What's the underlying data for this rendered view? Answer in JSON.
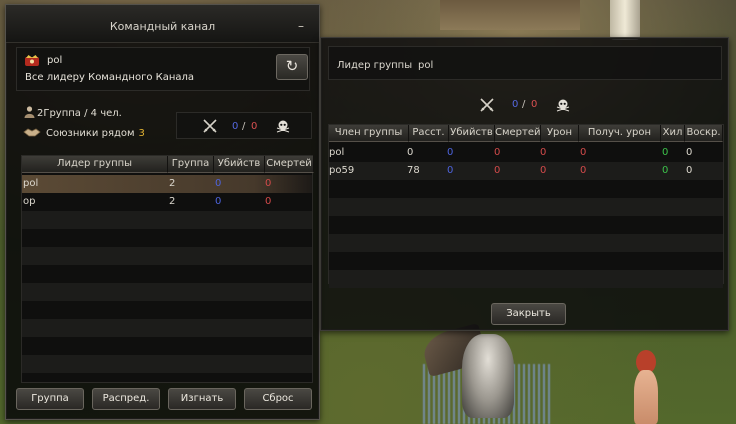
{
  "command_channel": {
    "title": "Командный канал",
    "minimize_label": "–",
    "leader_name": "pol",
    "leader_line": "Все лидеру Командного Канала",
    "refresh_icon": "refresh-icon",
    "groups_info": "2Группа / 4 чел.",
    "allies_label": "Союзники рядом",
    "allies_count": "3",
    "score": {
      "kills": "0",
      "separator": "/",
      "deaths": "0"
    },
    "table": {
      "headers": [
        "Лидер группы",
        "Группа",
        "Убийств",
        "Смертей"
      ],
      "rows": [
        {
          "leader": "pol",
          "group": "2",
          "kills": "0",
          "deaths": "0"
        },
        {
          "leader": "op",
          "group": "2",
          "kills": "0",
          "deaths": "0"
        }
      ]
    },
    "buttons": [
      "Группа",
      "Распред.",
      "Изгнать",
      "Сброс"
    ]
  },
  "party_detail": {
    "leader_label": "Лидер группы",
    "leader_name": "pol",
    "score": {
      "kills": "0",
      "separator": "/",
      "deaths": "0"
    },
    "table": {
      "headers": [
        "Член группы",
        "Расст.",
        "Убийств",
        "Смертей",
        "Урон",
        "Получ. урон",
        "Хил",
        "Воскр."
      ],
      "rows": [
        {
          "member": "pol",
          "distance": "0",
          "kills": "0",
          "deaths": "0",
          "damage": "0",
          "received": "0",
          "heal": "0",
          "revive": "0"
        },
        {
          "member": "po59",
          "distance": "78",
          "kills": "0",
          "deaths": "0",
          "damage": "0",
          "received": "0",
          "heal": "0",
          "revive": "0"
        }
      ]
    },
    "close_label": "Закрыть"
  },
  "colors": {
    "kills": "#4d63dc",
    "deaths": "#d24a4a",
    "heal": "#3cc24a",
    "allies": "#e0b232"
  }
}
